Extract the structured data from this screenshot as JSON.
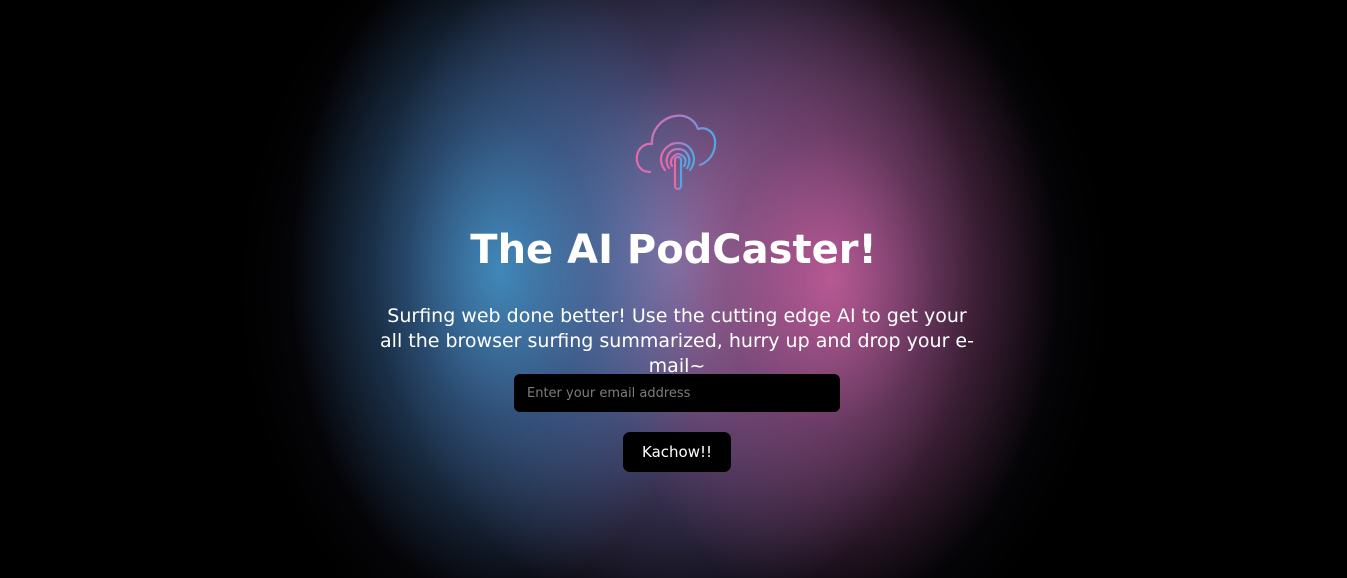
{
  "brand": {
    "logo_icon": "cloud-podcast-icon",
    "colors": {
      "logo_gradient_start": "#e66aa8",
      "logo_gradient_end": "#4fa8e6",
      "glow_blue": "#408cbe",
      "glow_pink": "#be5a96",
      "glow_violet": "#9687be"
    }
  },
  "hero": {
    "title": "The AI PodCaster!",
    "subtitle": "Surfing web done better! Use the cutting edge AI to get your all the browser surfing summarized, hurry up and drop your e-mail~"
  },
  "signup": {
    "email_placeholder": "Enter your email address",
    "email_value": "",
    "submit_label": "Kachow!!"
  }
}
